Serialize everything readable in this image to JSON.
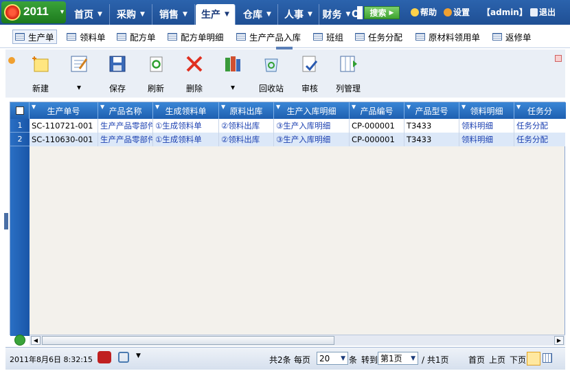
{
  "app": {
    "year": "2011"
  },
  "nav": {
    "items": [
      {
        "label": "首页"
      },
      {
        "label": "采购"
      },
      {
        "label": "销售"
      },
      {
        "label": "生产"
      },
      {
        "label": "仓库"
      },
      {
        "label": "人事"
      },
      {
        "label": "财务"
      },
      {
        "label": "O"
      }
    ],
    "active": "生产"
  },
  "search": {
    "button_label": "搜索"
  },
  "top_right": {
    "help": "帮助",
    "settings": "设置",
    "user": "【admin】",
    "logout": "退出"
  },
  "subnav": {
    "items": [
      "生产单",
      "领料单",
      "配方单",
      "配方单明细",
      "生产产品入库",
      "班组",
      "任务分配",
      "原材料领用单",
      "返修单"
    ]
  },
  "toolbar": {
    "buttons": [
      {
        "label": "新建",
        "icon": "new-icon"
      },
      {
        "label": "▾",
        "icon": "edit-icon"
      },
      {
        "label": "保存",
        "icon": "save-icon"
      },
      {
        "label": "刷新",
        "icon": "refresh-icon"
      },
      {
        "label": "删除",
        "icon": "delete-icon"
      },
      {
        "label": "▾",
        "icon": "books-icon"
      },
      {
        "label": "回收站",
        "icon": "recycle-icon"
      },
      {
        "label": "审核",
        "icon": "audit-icon"
      },
      {
        "label": "列管理",
        "icon": "columns-icon"
      }
    ]
  },
  "grid": {
    "columns": [
      "生产单号",
      "产品名称",
      "生成领料单",
      "原料出库",
      "生产入库明细",
      "产品编号",
      "产品型号",
      "领料明细",
      "任务分"
    ],
    "rows": [
      {
        "no": "1",
        "cells": [
          "SC-110721-001",
          "生产产品零部件",
          "①生成领料单",
          "②领料出库",
          "③生产入库明细",
          "CP-000001",
          "T3433",
          "领料明细",
          "任务分配"
        ]
      },
      {
        "no": "2",
        "cells": [
          "SC-110630-001",
          "生产产品零部件",
          "①生成领料单",
          "②领料出库",
          "③生产入库明细",
          "CP-000001",
          "T3433",
          "领料明细",
          "任务分配"
        ]
      }
    ]
  },
  "status": {
    "datetime": "2011年8月6日 8:32:15",
    "total": "共2条",
    "per_page_label": "每页",
    "per_page": "20",
    "unit": "条",
    "goto_label": "转到",
    "page": "第1页",
    "total_pages": "/ 共1页",
    "first": "首页",
    "prev": "上页",
    "next": "下页"
  }
}
